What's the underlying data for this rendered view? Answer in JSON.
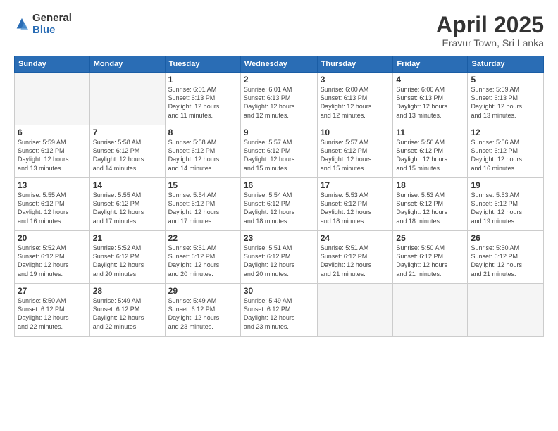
{
  "logo": {
    "general": "General",
    "blue": "Blue"
  },
  "title": "April 2025",
  "subtitle": "Eravur Town, Sri Lanka",
  "days_of_week": [
    "Sunday",
    "Monday",
    "Tuesday",
    "Wednesday",
    "Thursday",
    "Friday",
    "Saturday"
  ],
  "weeks": [
    [
      {
        "num": "",
        "info": ""
      },
      {
        "num": "",
        "info": ""
      },
      {
        "num": "1",
        "info": "Sunrise: 6:01 AM\nSunset: 6:13 PM\nDaylight: 12 hours\nand 11 minutes."
      },
      {
        "num": "2",
        "info": "Sunrise: 6:01 AM\nSunset: 6:13 PM\nDaylight: 12 hours\nand 12 minutes."
      },
      {
        "num": "3",
        "info": "Sunrise: 6:00 AM\nSunset: 6:13 PM\nDaylight: 12 hours\nand 12 minutes."
      },
      {
        "num": "4",
        "info": "Sunrise: 6:00 AM\nSunset: 6:13 PM\nDaylight: 12 hours\nand 13 minutes."
      },
      {
        "num": "5",
        "info": "Sunrise: 5:59 AM\nSunset: 6:13 PM\nDaylight: 12 hours\nand 13 minutes."
      }
    ],
    [
      {
        "num": "6",
        "info": "Sunrise: 5:59 AM\nSunset: 6:12 PM\nDaylight: 12 hours\nand 13 minutes."
      },
      {
        "num": "7",
        "info": "Sunrise: 5:58 AM\nSunset: 6:12 PM\nDaylight: 12 hours\nand 14 minutes."
      },
      {
        "num": "8",
        "info": "Sunrise: 5:58 AM\nSunset: 6:12 PM\nDaylight: 12 hours\nand 14 minutes."
      },
      {
        "num": "9",
        "info": "Sunrise: 5:57 AM\nSunset: 6:12 PM\nDaylight: 12 hours\nand 15 minutes."
      },
      {
        "num": "10",
        "info": "Sunrise: 5:57 AM\nSunset: 6:12 PM\nDaylight: 12 hours\nand 15 minutes."
      },
      {
        "num": "11",
        "info": "Sunrise: 5:56 AM\nSunset: 6:12 PM\nDaylight: 12 hours\nand 15 minutes."
      },
      {
        "num": "12",
        "info": "Sunrise: 5:56 AM\nSunset: 6:12 PM\nDaylight: 12 hours\nand 16 minutes."
      }
    ],
    [
      {
        "num": "13",
        "info": "Sunrise: 5:55 AM\nSunset: 6:12 PM\nDaylight: 12 hours\nand 16 minutes."
      },
      {
        "num": "14",
        "info": "Sunrise: 5:55 AM\nSunset: 6:12 PM\nDaylight: 12 hours\nand 17 minutes."
      },
      {
        "num": "15",
        "info": "Sunrise: 5:54 AM\nSunset: 6:12 PM\nDaylight: 12 hours\nand 17 minutes."
      },
      {
        "num": "16",
        "info": "Sunrise: 5:54 AM\nSunset: 6:12 PM\nDaylight: 12 hours\nand 18 minutes."
      },
      {
        "num": "17",
        "info": "Sunrise: 5:53 AM\nSunset: 6:12 PM\nDaylight: 12 hours\nand 18 minutes."
      },
      {
        "num": "18",
        "info": "Sunrise: 5:53 AM\nSunset: 6:12 PM\nDaylight: 12 hours\nand 18 minutes."
      },
      {
        "num": "19",
        "info": "Sunrise: 5:53 AM\nSunset: 6:12 PM\nDaylight: 12 hours\nand 19 minutes."
      }
    ],
    [
      {
        "num": "20",
        "info": "Sunrise: 5:52 AM\nSunset: 6:12 PM\nDaylight: 12 hours\nand 19 minutes."
      },
      {
        "num": "21",
        "info": "Sunrise: 5:52 AM\nSunset: 6:12 PM\nDaylight: 12 hours\nand 20 minutes."
      },
      {
        "num": "22",
        "info": "Sunrise: 5:51 AM\nSunset: 6:12 PM\nDaylight: 12 hours\nand 20 minutes."
      },
      {
        "num": "23",
        "info": "Sunrise: 5:51 AM\nSunset: 6:12 PM\nDaylight: 12 hours\nand 20 minutes."
      },
      {
        "num": "24",
        "info": "Sunrise: 5:51 AM\nSunset: 6:12 PM\nDaylight: 12 hours\nand 21 minutes."
      },
      {
        "num": "25",
        "info": "Sunrise: 5:50 AM\nSunset: 6:12 PM\nDaylight: 12 hours\nand 21 minutes."
      },
      {
        "num": "26",
        "info": "Sunrise: 5:50 AM\nSunset: 6:12 PM\nDaylight: 12 hours\nand 21 minutes."
      }
    ],
    [
      {
        "num": "27",
        "info": "Sunrise: 5:50 AM\nSunset: 6:12 PM\nDaylight: 12 hours\nand 22 minutes."
      },
      {
        "num": "28",
        "info": "Sunrise: 5:49 AM\nSunset: 6:12 PM\nDaylight: 12 hours\nand 22 minutes."
      },
      {
        "num": "29",
        "info": "Sunrise: 5:49 AM\nSunset: 6:12 PM\nDaylight: 12 hours\nand 23 minutes."
      },
      {
        "num": "30",
        "info": "Sunrise: 5:49 AM\nSunset: 6:12 PM\nDaylight: 12 hours\nand 23 minutes."
      },
      {
        "num": "",
        "info": ""
      },
      {
        "num": "",
        "info": ""
      },
      {
        "num": "",
        "info": ""
      }
    ]
  ]
}
